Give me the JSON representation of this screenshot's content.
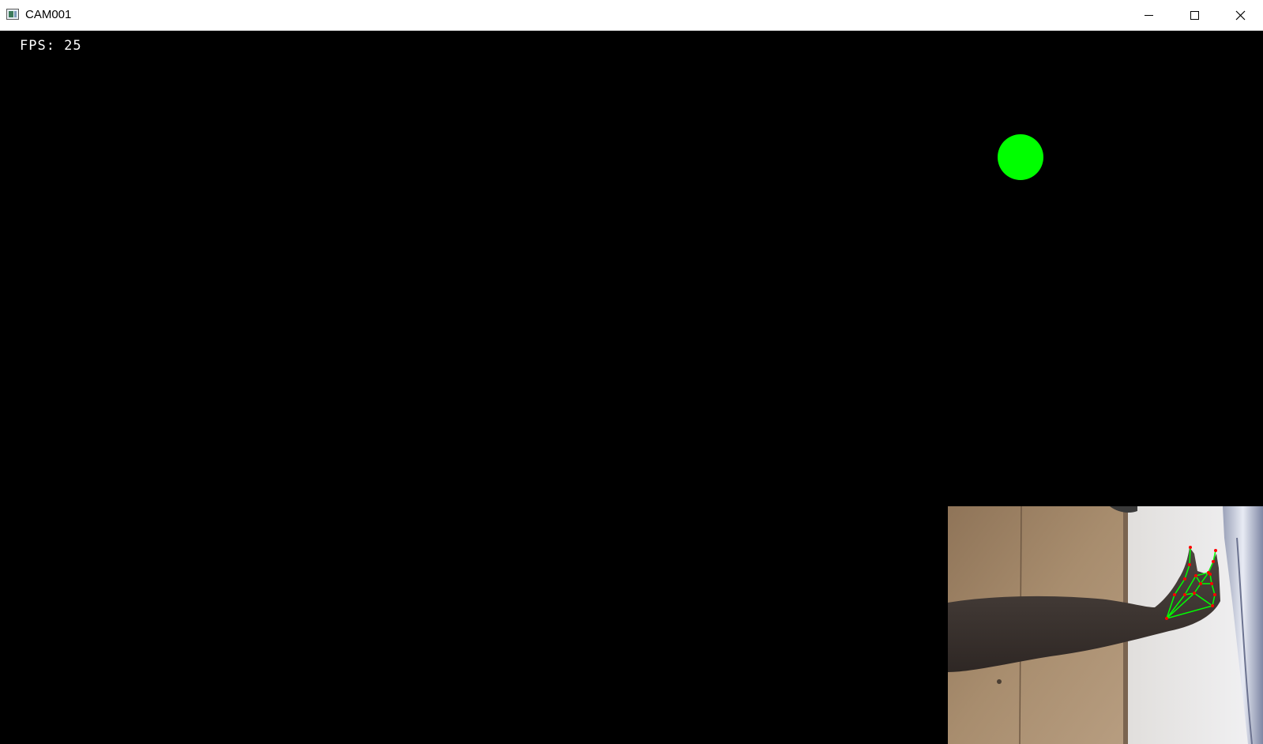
{
  "window": {
    "title": "CAM001",
    "controls": {
      "minimize_icon": "minimize-icon",
      "maximize_icon": "maximize-icon",
      "close_icon": "close-icon"
    }
  },
  "overlay": {
    "fps_text": "FPS: 25"
  },
  "target": {
    "color": "#00ff00"
  },
  "preview": {
    "landmark_line_color": "#00ff00",
    "landmark_point_color": "#ff0000"
  }
}
